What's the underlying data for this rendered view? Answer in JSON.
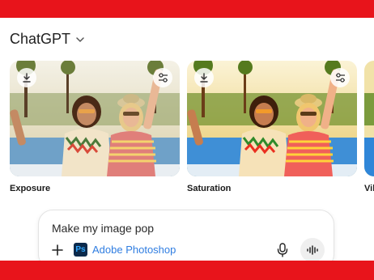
{
  "app": {
    "title": "ChatGPT",
    "brand_color": "#e8141b"
  },
  "header": {
    "chevron_icon": "chevron-down-icon"
  },
  "gallery": {
    "cards": [
      {
        "label": "Exposure",
        "download_icon": "download-icon",
        "adjust_icon": "sliders-icon"
      },
      {
        "label": "Saturation",
        "download_icon": "download-icon",
        "adjust_icon": "sliders-icon"
      },
      {
        "label": "Vib"
      }
    ]
  },
  "composer": {
    "input_text": "Make my image pop",
    "add_icon": "plus-icon",
    "app_chip": {
      "logo_text": "Ps",
      "label": "Adobe Photoshop",
      "label_color": "#2f7de1"
    },
    "mic_icon": "microphone-icon",
    "voice_icon": "voice-waveform-icon"
  }
}
